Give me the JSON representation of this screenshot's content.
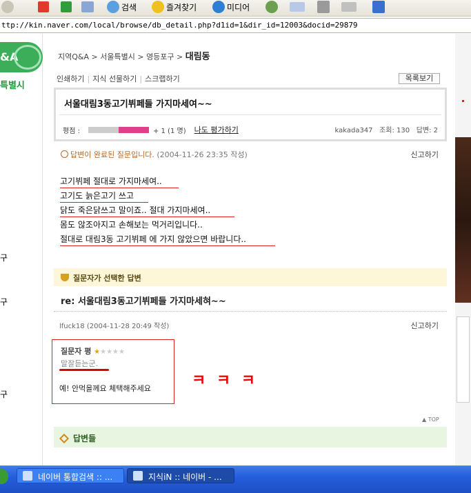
{
  "toolbar": {
    "search_label": "검색",
    "favorites_label": "즐겨찾기",
    "media_label": "미디어"
  },
  "address": {
    "url": "ttp://kin.naver.com/local/browse/db_detail.php?d1id=1&dir_id=12003&docid=29879"
  },
  "left": {
    "logo_text": "&A",
    "sub_text": "특별시",
    "glyphs": [
      "구",
      "구",
      "구"
    ]
  },
  "breadcrumb": {
    "part1": "지역Q&A",
    "part2": "서울특별시",
    "part3": "영등포구",
    "current": "대림동",
    "sep": ">"
  },
  "actions": {
    "print": "인쇄하기",
    "gift": "지식 선물하기",
    "scrap": "스크랩하기",
    "list": "목록보기"
  },
  "question": {
    "title": "서울대림3동고기뷔페들 가지마세여~~",
    "rating_label": "평점 :",
    "rating_count": "+ 1 (1 명)",
    "rate_link": "나도 평가하기",
    "author": "kakada347",
    "views": "조회: 130",
    "answers": "답변: 2"
  },
  "status": {
    "done_text": "답변이 완료된 질문입니다.",
    "date": "(2004-11-26 23:35 작성)",
    "report": "신고하기"
  },
  "body_lines": [
    "고기뷔페 절대로 가지마세여..",
    "고기도 늙은고기 쓰고",
    "닭도 죽은닭쓰고 말이죠.. 절대 가지마세여..",
    "몸도 않조아지고 손해보는 먹거리입니다..",
    "절대로 대림3동 고기뷔페 에 가지 않았으면 바랍니다.."
  ],
  "selected_answer": {
    "header": "질문자가 선택한 답변",
    "title": "re: 서울대림3동고기뷔페들 가지마세혀~~",
    "meta": "lfuck18 (2004-11-28 20:49 작성)",
    "report": "신고하기",
    "eval_label": "질문자 평",
    "stars_on": "★",
    "stars_off": "★★★★",
    "eval_text": "말잘듣는군.",
    "thanks": "예! 안먹을께요 체택해주세요"
  },
  "annotation": {
    "kkk": "ㅋ ㅋ ㅋ"
  },
  "top_link": "▲ TOP",
  "answers_section": {
    "header": "답변들"
  },
  "taskbar": {
    "task1": "네이버 통합검색 :: ...",
    "task2": "지식iN :: 네이버 - ..."
  },
  "colors": {
    "accent_green": "#3cae5a",
    "underline_red": "#d22",
    "status_orange": "#b06a2f",
    "rating_pink": "#e0408a"
  }
}
